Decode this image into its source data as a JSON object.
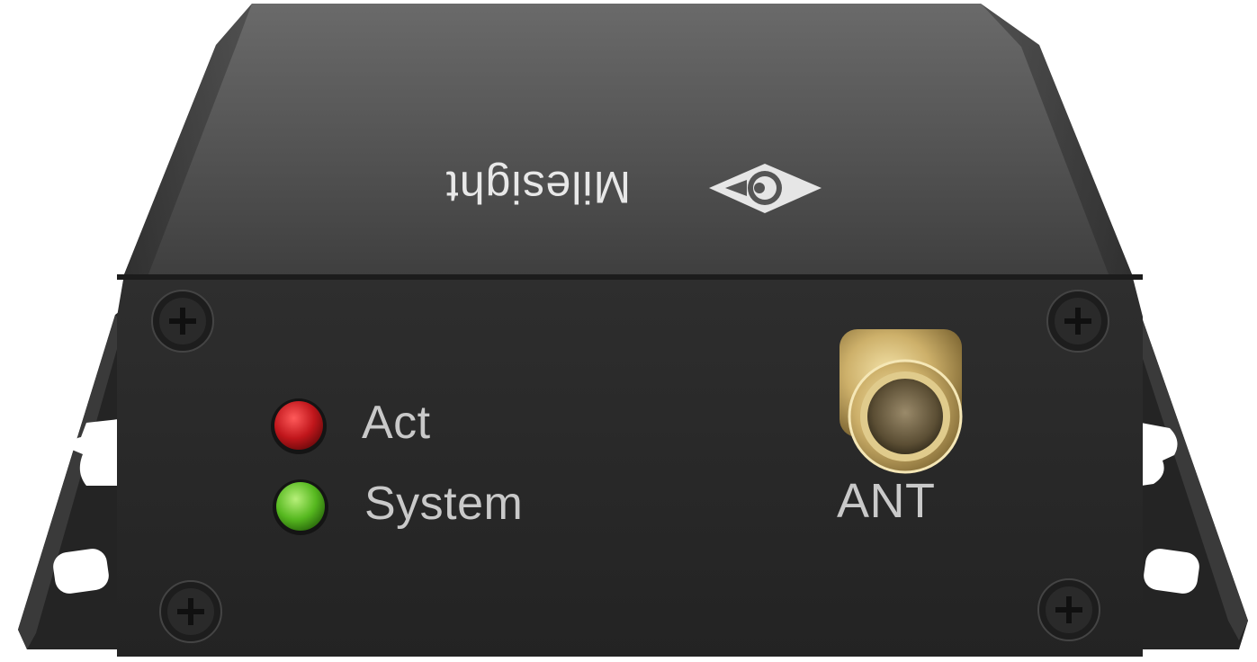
{
  "device": {
    "brand_text": "Milesight",
    "leds": [
      {
        "label": "Act",
        "color": "#c0161b"
      },
      {
        "label": "System",
        "color": "#56b81f"
      }
    ],
    "connector_label": "ANT",
    "colors": {
      "body": "#2b2b2b",
      "top": "#3d3d3d",
      "front": "#262626",
      "bracket": "#262626",
      "connector": "#cdb06a",
      "label_text": "#c9c9c9"
    },
    "screw_count": 4,
    "icons": [
      "milesight-logo-icon",
      "screw-icon",
      "sma-connector-icon"
    ]
  }
}
